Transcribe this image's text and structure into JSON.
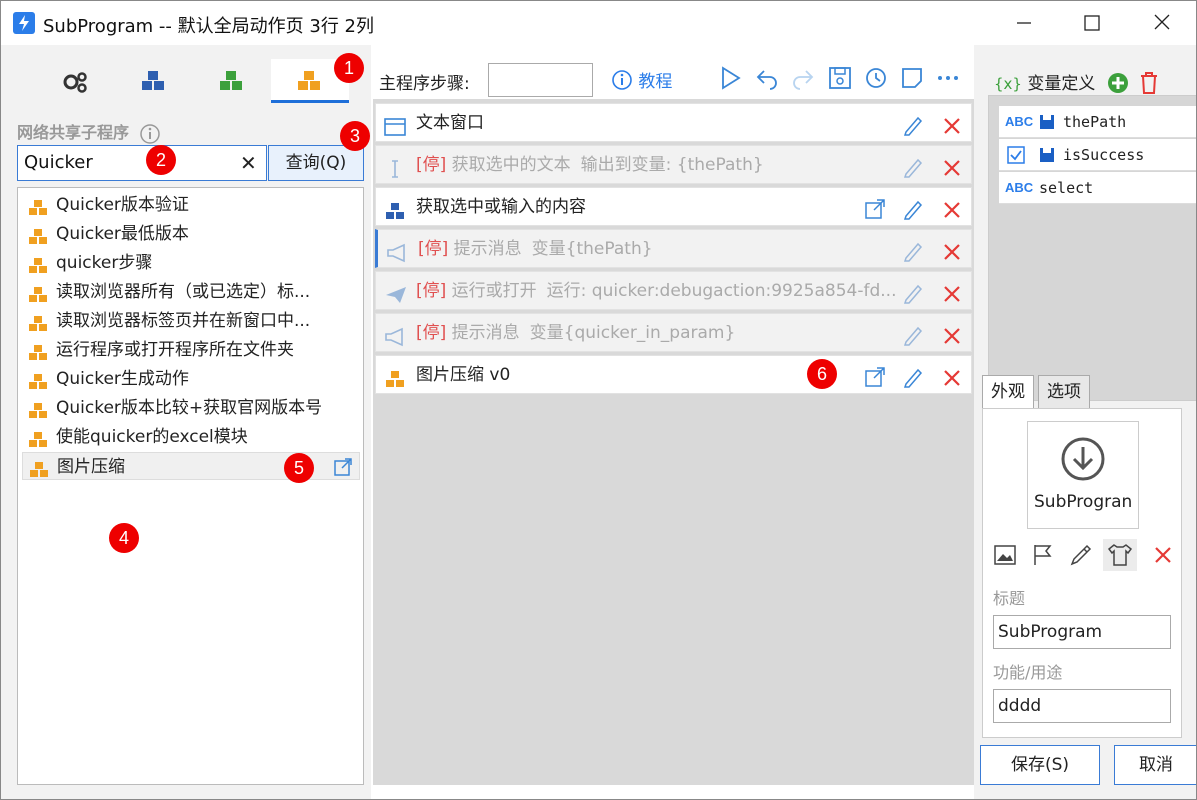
{
  "window": {
    "title": "SubProgram -- 默认全局动作页 3行 2列"
  },
  "badges": [
    "1",
    "2",
    "3",
    "4",
    "5",
    "6"
  ],
  "left": {
    "section_label": "网络共享子程序",
    "search_value": "Quicker",
    "query_button": "查询(Q)",
    "items": [
      "Quicker版本验证",
      "Quicker最低版本",
      "quicker步骤",
      "读取浏览器所有（或已选定）标...",
      "读取浏览器标签页并在新窗口中...",
      "运行程序或打开程序所在文件夹",
      "Quicker生成动作",
      "Quicker版本比较+获取官网版本号",
      "使能quicker的excel模块",
      "图片压缩"
    ]
  },
  "main": {
    "steps_label": "主程序步骤:",
    "tutorial": "教程",
    "steps": [
      {
        "stop": "",
        "text": "文本窗口",
        "sub": ""
      },
      {
        "stop": "[停]",
        "text": "获取选中的文本",
        "sub": "输出到变量: {thePath}"
      },
      {
        "stop": "",
        "text": "获取选中或输入的内容",
        "sub": ""
      },
      {
        "stop": "[停]",
        "text": "提示消息",
        "sub": "变量{thePath}"
      },
      {
        "stop": "[停]",
        "text": "运行或打开",
        "sub": "运行: quicker:debugaction:9925a854-fd..."
      },
      {
        "stop": "[停]",
        "text": "提示消息",
        "sub": "变量{quicker_in_param}"
      },
      {
        "stop": "",
        "text": "图片压缩 v0",
        "sub": ""
      }
    ]
  },
  "right": {
    "var_header_icon": "{x}",
    "var_header": "变量定义",
    "vars": [
      {
        "type": "ABC",
        "name": "thePath"
      },
      {
        "type": "",
        "name": "isSuccess"
      },
      {
        "type": "ABC",
        "name": "select"
      }
    ],
    "tab_appearance": "外观",
    "tab_options": "选项",
    "icon_caption": "SubProgran",
    "title_label": "标题",
    "title_value": "SubProgram",
    "purpose_label": "功能/用途",
    "purpose_value": "dddd",
    "save_button": "保存(S)",
    "cancel_button": "取消"
  },
  "colors": {
    "accent": "#2b7de9",
    "danger": "#e53935",
    "cube": "#f0a020",
    "badge": "#ee0000"
  }
}
